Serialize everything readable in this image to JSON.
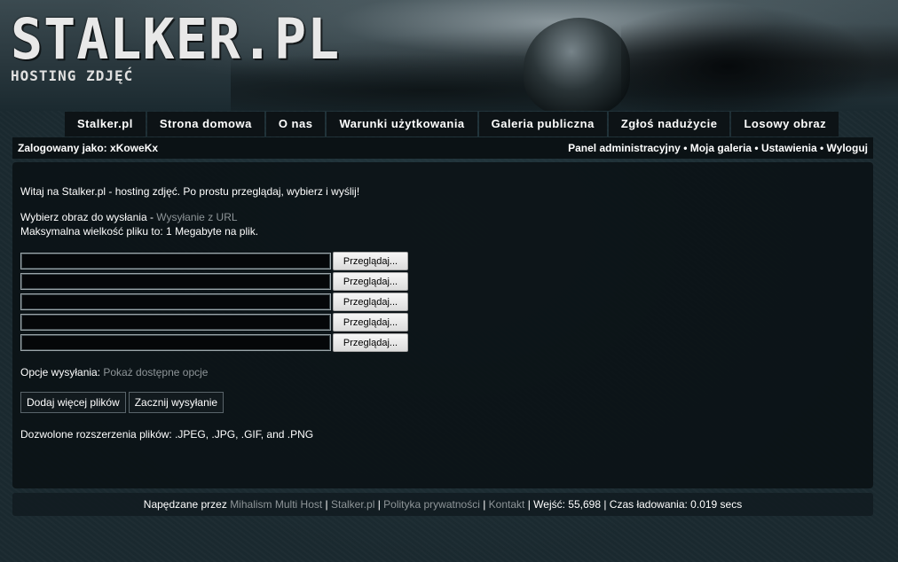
{
  "header": {
    "logo_title": "STALKER.PL",
    "logo_subtitle": "HOSTING ZDJĘĆ"
  },
  "nav": {
    "items": [
      {
        "label": "Stalker.pl"
      },
      {
        "label": "Strona domowa"
      },
      {
        "label": "O nas"
      },
      {
        "label": "Warunki użytkowania"
      },
      {
        "label": "Galeria publiczna"
      },
      {
        "label": "Zgłoś nadużycie"
      },
      {
        "label": "Losowy obraz"
      }
    ]
  },
  "userbar": {
    "logged_in_as": "Zalogowany jako: xKoweKx",
    "links": [
      "Panel administracyjny",
      "Moja galeria",
      "Ustawienia",
      "Wyloguj"
    ],
    "separator": " • "
  },
  "main": {
    "welcome": "Witaj na Stalker.pl - hosting zdjęć. Po prostu przeglądaj, wybierz i wyślij!",
    "choose_text": "Wybierz obraz do wysłania - ",
    "url_upload_link": "Wysyłanie z URL",
    "max_size": "Maksymalna wielkość pliku to: 1 Megabyte na plik.",
    "browse_label": "Przeglądaj...",
    "file_count": 5,
    "options_label": "Opcje wysyłania: ",
    "options_link": "Pokaż dostępne opcje",
    "add_more_label": "Dodaj więcej plików",
    "start_upload_label": "Zacznij wysyłanie",
    "allowed_ext": "Dozwolone rozszerzenia plików: .JPEG, .JPG, .GIF, and .PNG"
  },
  "footer": {
    "powered_by": "Napędzane przez ",
    "mihalism_link": "Mihalism Multi Host",
    "sep": " | ",
    "stalker_link": "Stalker.pl",
    "privacy_link": "Polityka prywatności",
    "contact_link": "Kontakt",
    "visits": "Wejść: 55,698",
    "load_time": "Czas ładowania: 0.019 secs"
  },
  "colors": {
    "background": "#1b2a30",
    "panel": "#0a1115",
    "link_gray": "#8e9598",
    "text": "#ffffff"
  }
}
